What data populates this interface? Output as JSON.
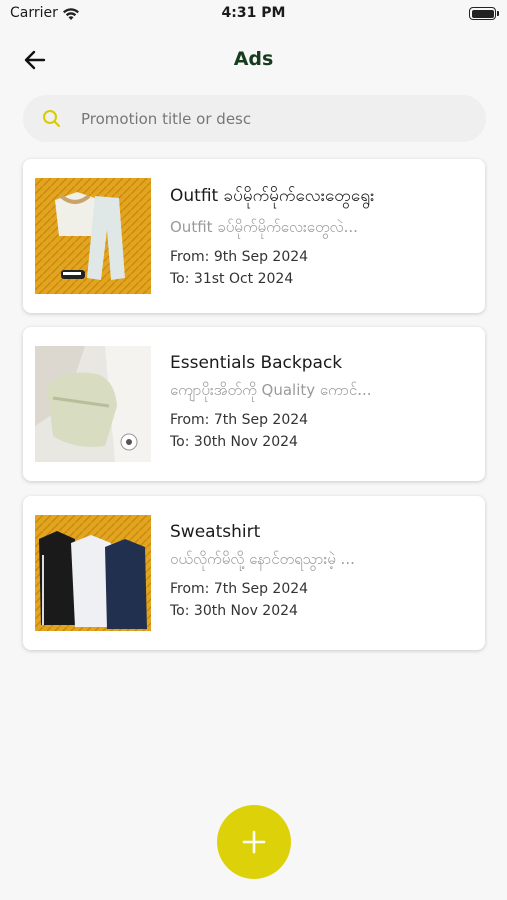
{
  "status_bar": {
    "carrier": "Carrier",
    "time": "4:31 PM"
  },
  "header": {
    "title": "Ads",
    "back_icon": "arrow-left-icon"
  },
  "search": {
    "placeholder": "Promotion title or desc",
    "value": "",
    "icon": "search-icon",
    "icon_color": "#d8cb00"
  },
  "ads": [
    {
      "title": "Outfit ခပ်မိုက်မိုက်လေးတွေရွေး",
      "description": "Outfit ခပ်မိုက်မိုက်လေးတွေလဲ...",
      "from": "From: 9th Sep 2024",
      "to": "To: 31st Oct 2024"
    },
    {
      "title": "Essentials Backpack",
      "description": "ကျောပိုးအိတ်ကို Quality ကောင်...",
      "from": "From: 7th Sep 2024",
      "to": "To: 30th Nov 2024"
    },
    {
      "title": "Sweatshirt",
      "description": "ဝယ်လိုက်မိလို့ နောင်တရသွားမဲ့ ...",
      "from": "From: 7th Sep 2024",
      "to": "To: 30th Nov 2024"
    }
  ],
  "fab": {
    "icon": "plus-icon",
    "color": "#ddd20a"
  }
}
